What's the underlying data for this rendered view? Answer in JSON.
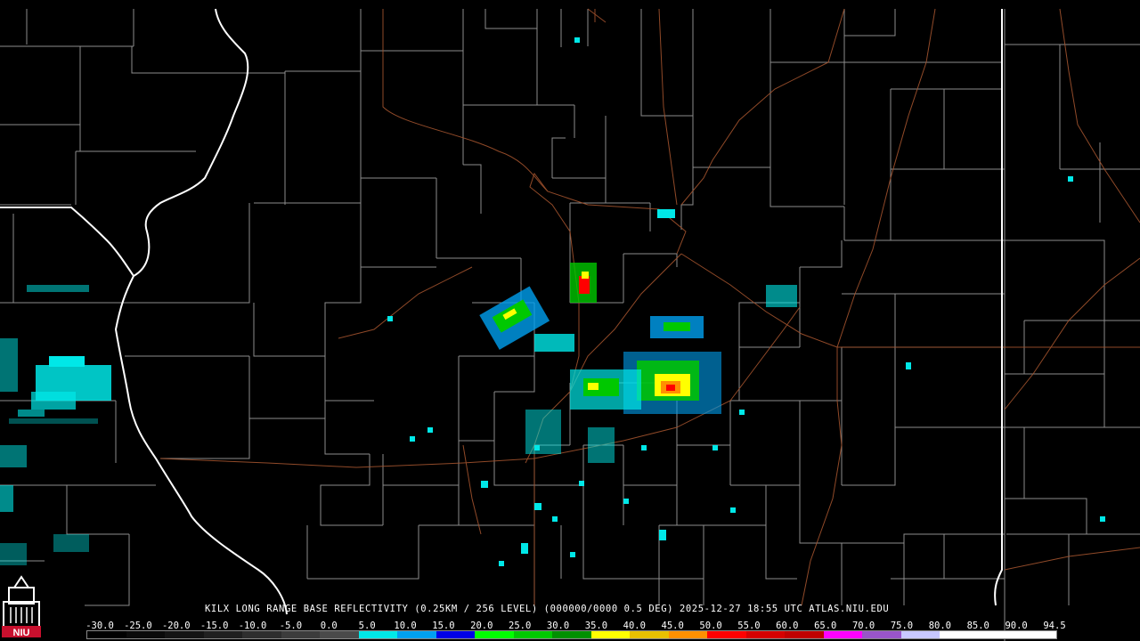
{
  "product_caption": "KILX LONG RANGE BASE REFLECTIVITY (0.25KM / 256 LEVEL) (000000/0000 0.5 DEG) 2025-12-27 18:55 UTC  ATLAS.NIU.EDU",
  "logo": {
    "text": "NIU",
    "color": "#c8102e"
  },
  "scale": {
    "labels": [
      "-30.0",
      "-25.0",
      "-20.0",
      "-15.0",
      "-10.0",
      "-5.0",
      "0.0",
      "5.0",
      "10.0",
      "15.0",
      "20.0",
      "25.0",
      "30.0",
      "35.0",
      "40.0",
      "45.0",
      "50.0",
      "55.0",
      "60.0",
      "65.0",
      "70.0",
      "75.0",
      "80.0",
      "85.0",
      "90.0",
      "94.5"
    ],
    "colors": [
      "#000000",
      "#0a0a0a",
      "#141414",
      "#202020",
      "#2e2e2e",
      "#3c3c3c",
      "#4a4a4a",
      "#00e8e8",
      "#00a0f0",
      "#0000e8",
      "#00ff00",
      "#00c800",
      "#009000",
      "#ffff00",
      "#e8c000",
      "#ff9000",
      "#ff0000",
      "#d60000",
      "#c00000",
      "#ff00ff",
      "#9955c9",
      "#c8c8ff",
      "#ffffff",
      "#ffffff",
      "#ffffff"
    ]
  },
  "map_colors": {
    "county": "#8c8c8c",
    "state": "#ffffff",
    "highway": "#a0522d"
  }
}
